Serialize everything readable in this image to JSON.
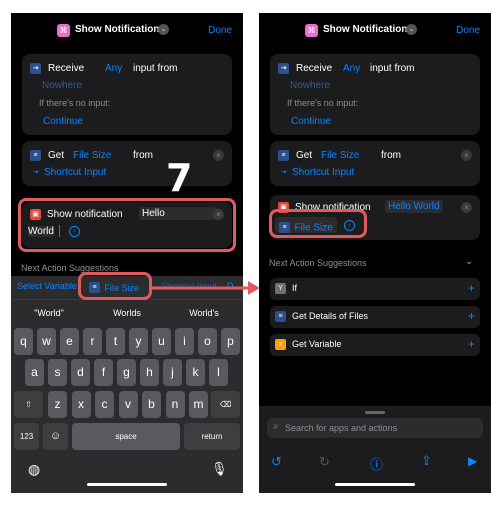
{
  "step_number": "7",
  "header": {
    "app_icon": "shortcut-icon",
    "title": "Show Notification",
    "done": "Done"
  },
  "receive": {
    "label": "Receive",
    "any": "Any",
    "input_from": "input from",
    "source": "Nowhere",
    "no_input_label": "If there's no input:",
    "continue": "Continue"
  },
  "get_action": {
    "label": "Get",
    "property": "File Size",
    "from": "from",
    "source": "Shortcut Input"
  },
  "left": {
    "notification": {
      "label": "Show notification",
      "value_part1": "Hello",
      "value_part2": "World"
    },
    "suggestions_title": "Next Action Suggestions",
    "variable_bar": {
      "select_variable": "Select Variable",
      "file_size": "File Size",
      "shortcut": "Shortcut Input",
      "more": "D"
    },
    "keyboard": {
      "suggestions": [
        "\"World\"",
        "Worlds",
        "World's"
      ],
      "row1": [
        "q",
        "w",
        "e",
        "r",
        "t",
        "y",
        "u",
        "i",
        "o",
        "p"
      ],
      "row2": [
        "a",
        "s",
        "d",
        "f",
        "g",
        "h",
        "j",
        "k",
        "l"
      ],
      "row3": [
        "z",
        "x",
        "c",
        "v",
        "b",
        "n",
        "m"
      ],
      "numbers": "123",
      "space": "space",
      "return": "return"
    }
  },
  "right": {
    "notification": {
      "label": "Show notification",
      "value": "Hello World",
      "variable": "File Size"
    },
    "suggestions_title": "Next Action Suggestions",
    "suggestions": [
      {
        "icon": "if-icon",
        "label": "If"
      },
      {
        "icon": "file-details-icon",
        "label": "Get Details of Files"
      },
      {
        "icon": "variable-icon",
        "label": "Get Variable"
      }
    ],
    "search_placeholder": "Search for apps and actions"
  },
  "colors": {
    "accent": "#0a84ff",
    "highlight": "#e05a5e",
    "background": "#000000",
    "card": "#1c1c1e"
  }
}
